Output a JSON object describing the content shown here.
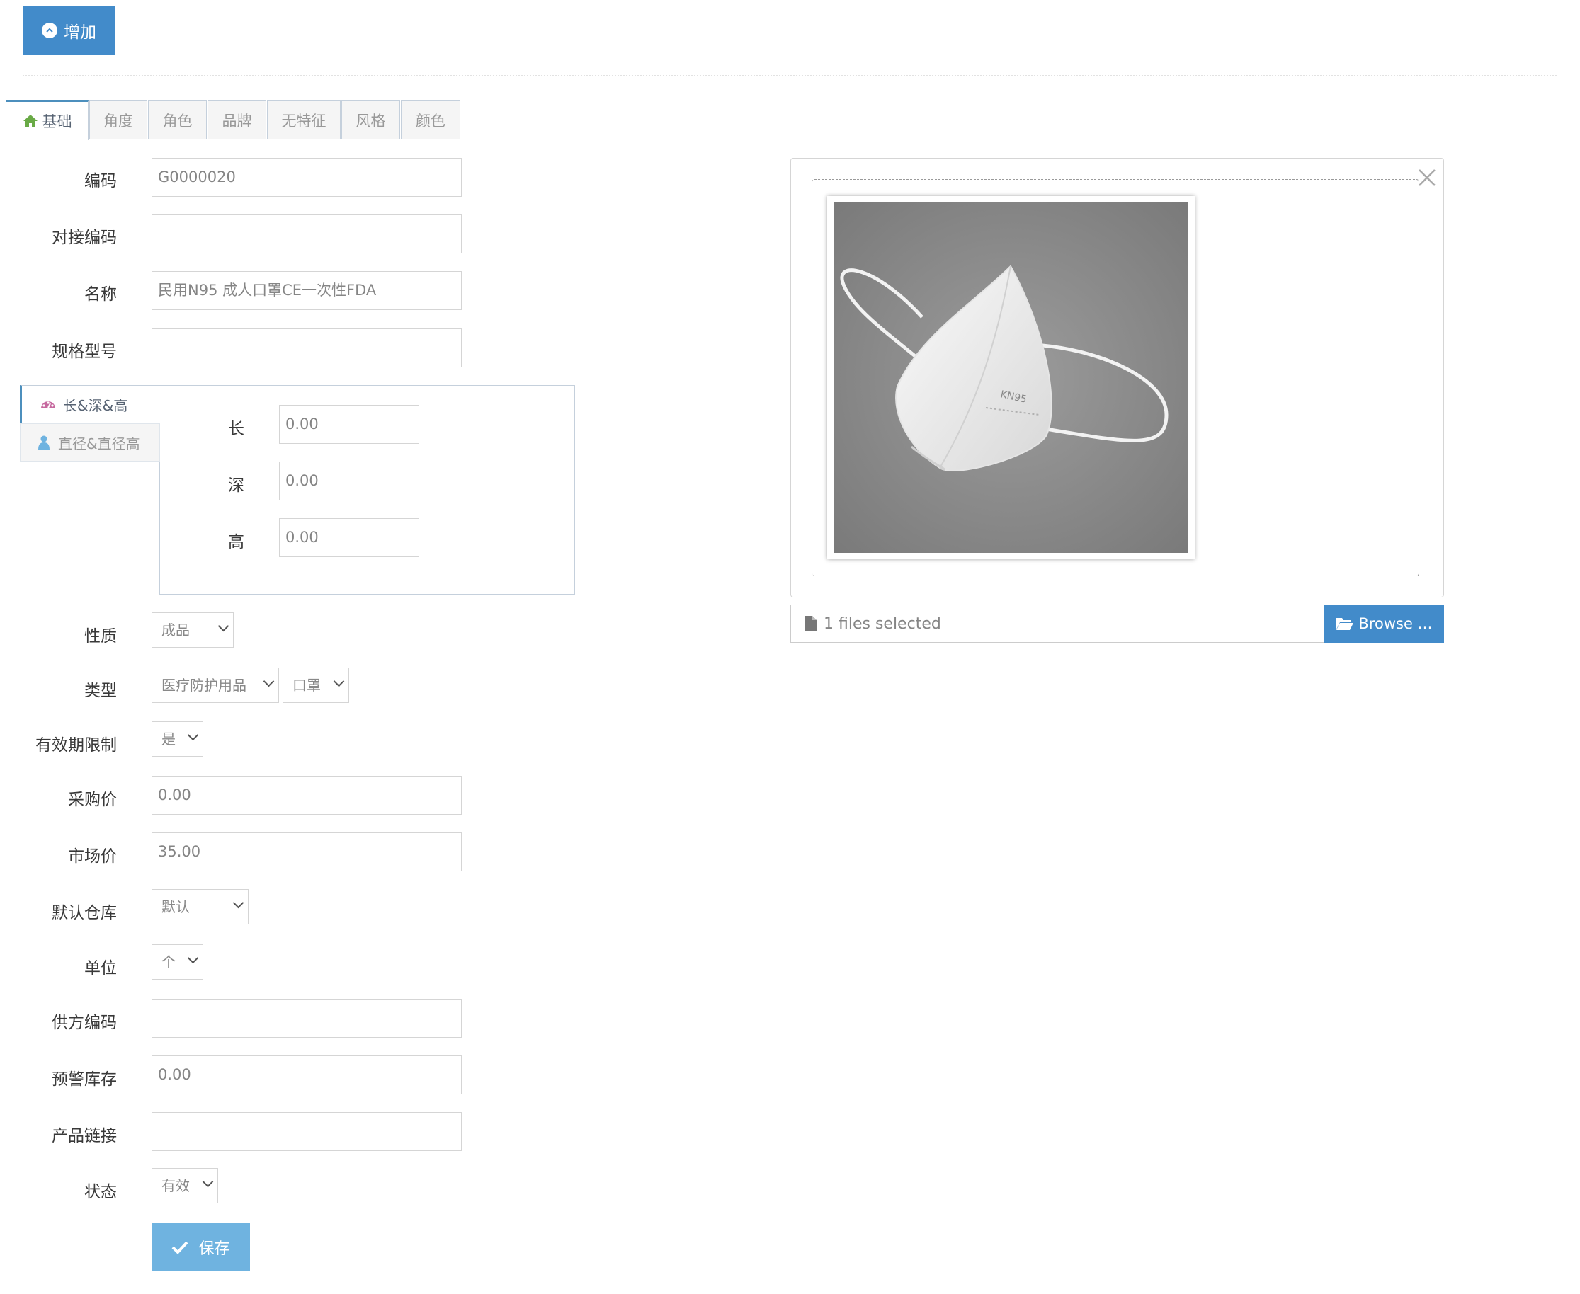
{
  "toolbar": {
    "add_label": "增加"
  },
  "tabs": [
    "基础",
    "角度",
    "角色",
    "品牌",
    "无特征",
    "风格",
    "颜色"
  ],
  "form": {
    "code": {
      "label": "编码",
      "value": "G0000020"
    },
    "dock_code": {
      "label": "对接编码",
      "value": ""
    },
    "name": {
      "label": "名称",
      "value": "民用N95 成人口罩CE一次性FDA"
    },
    "spec": {
      "label": "规格型号",
      "value": ""
    },
    "nature": {
      "label": "性质",
      "value": "成品"
    },
    "type": {
      "label": "类型",
      "value1": "医疗防护用品",
      "value2": "口罩"
    },
    "expiry": {
      "label": "有效期限制",
      "value": "是"
    },
    "purchase_price": {
      "label": "采购价",
      "value": "0.00"
    },
    "market_price": {
      "label": "市场价",
      "value": "35.00"
    },
    "warehouse": {
      "label": "默认仓库",
      "value": "默认"
    },
    "unit": {
      "label": "单位",
      "value": "个"
    },
    "supplier_code": {
      "label": "供方编码",
      "value": ""
    },
    "alert_stock": {
      "label": "预警库存",
      "value": "0.00"
    },
    "product_link": {
      "label": "产品链接",
      "value": ""
    },
    "status": {
      "label": "状态",
      "value": "有效"
    },
    "save_label": "保存"
  },
  "dimensions": {
    "tabs": [
      "长&深&高",
      "直径&直径高"
    ],
    "length": {
      "label": "长",
      "value": "0.00"
    },
    "depth": {
      "label": "深",
      "value": "0.00"
    },
    "height": {
      "label": "高",
      "value": "0.00"
    }
  },
  "upload": {
    "status_text": "1 files selected",
    "browse_label": "Browse …"
  },
  "colors": {
    "primary": "#428bca",
    "save": "#6fb3e0",
    "tab_border": "#c5d0dc",
    "house_icon": "#69aa46",
    "palette_icon": "#c6699f",
    "user_icon": "#6fb3e0"
  }
}
